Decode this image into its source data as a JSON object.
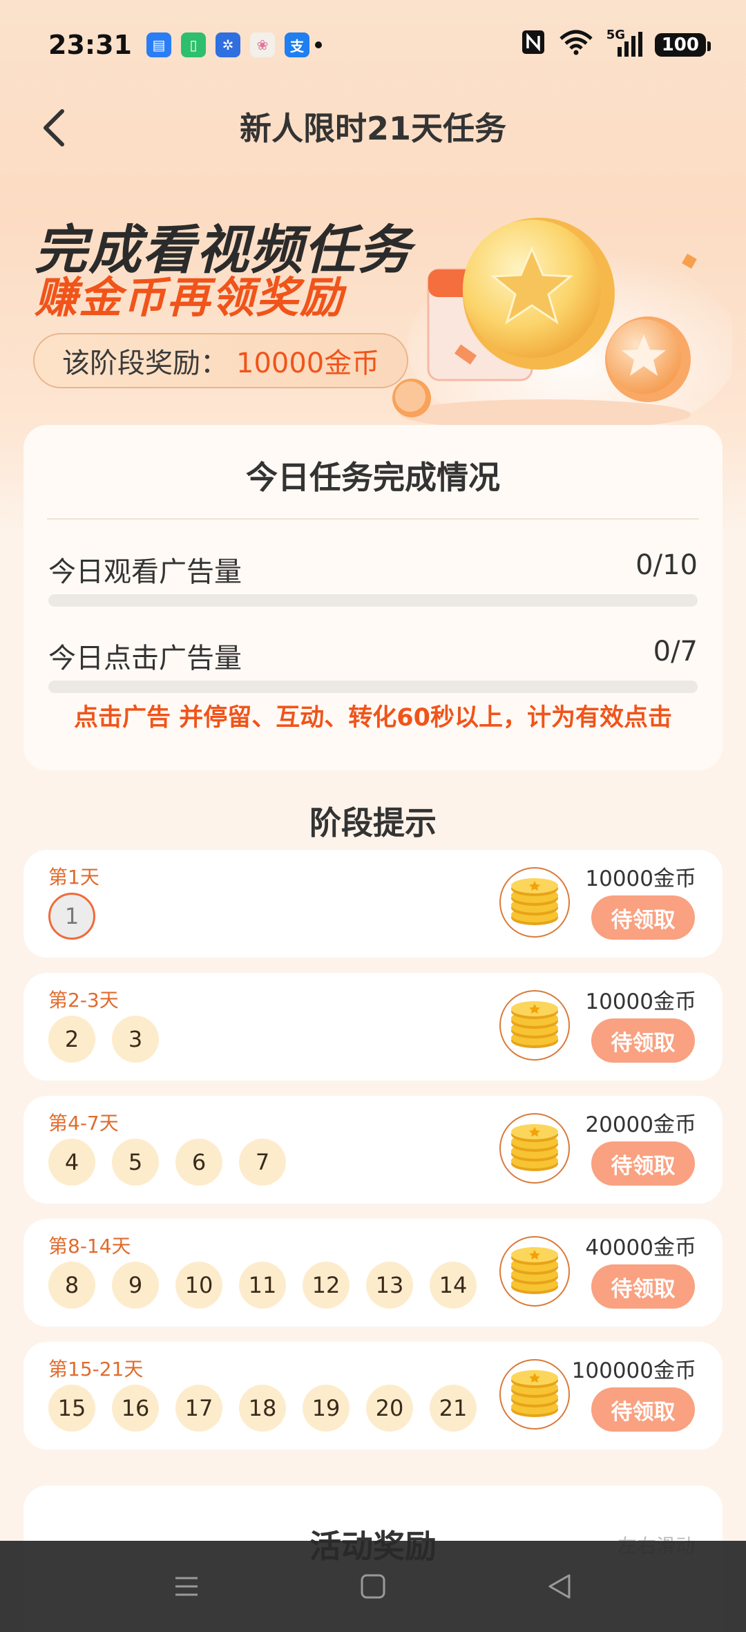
{
  "status_bar": {
    "time": "23:31",
    "apps": [
      {
        "icon": "message-icon",
        "color": "#2a7ef5",
        "glyph": "▤"
      },
      {
        "icon": "battery-app-icon",
        "color": "#2dbf6c",
        "glyph": "▯"
      },
      {
        "icon": "pinwheel-icon",
        "color": "#2f6fe0",
        "glyph": "✲"
      },
      {
        "icon": "photos-icon",
        "color": "#f3efe9",
        "glyph": "❀"
      },
      {
        "icon": "alipay-icon",
        "color": "#1f7ef0",
        "glyph": "支"
      }
    ],
    "network": "5G",
    "battery": "100"
  },
  "nav": {
    "title": "新人限时21天任务"
  },
  "hero": {
    "line1": "完成看视频任务",
    "line2": "赚金币再领奖励",
    "pill_label": "该阶段奖励：",
    "pill_value": "10000金币"
  },
  "today": {
    "title": "今日任务完成情况",
    "metrics": [
      {
        "label": "今日观看广告量",
        "value": "0/10",
        "progress": 0
      },
      {
        "label": "今日点击广告量",
        "value": "0/7",
        "progress": 0
      }
    ],
    "note": "点击广告 并停留、互动、转化60秒以上，计为有效点击"
  },
  "stages_header": "阶段提示",
  "stages": [
    {
      "label": "第1天",
      "days": [
        "1"
      ],
      "current_day": "1",
      "reward": "10000金币",
      "button": "待领取"
    },
    {
      "label": "第2-3天",
      "days": [
        "2",
        "3"
      ],
      "reward": "10000金币",
      "button": "待领取"
    },
    {
      "label": "第4-7天",
      "days": [
        "4",
        "5",
        "6",
        "7"
      ],
      "reward": "20000金币",
      "button": "待领取"
    },
    {
      "label": "第8-14天",
      "days": [
        "8",
        "9",
        "10",
        "11",
        "12",
        "13",
        "14"
      ],
      "reward": "40000金币",
      "button": "待领取"
    },
    {
      "label": "第15-21天",
      "days": [
        "15",
        "16",
        "17",
        "18",
        "19",
        "20",
        "21"
      ],
      "reward": "100000金币",
      "button": "待领取"
    }
  ],
  "activity": {
    "title": "活动奖励",
    "hint": "左右滑动"
  },
  "colors": {
    "accent": "#f0541a",
    "claim_button": "#f9a180",
    "day_circle": "#fdeccc"
  }
}
